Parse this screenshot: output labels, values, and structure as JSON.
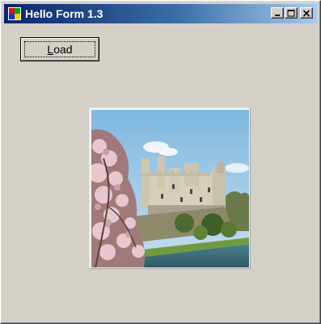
{
  "window": {
    "title": "Hello Form 1.3",
    "controls": {
      "minimize": "_",
      "maximize": "□",
      "close": "×"
    }
  },
  "toolbar": {
    "load_mnemonic": "L",
    "load_rest": "oad"
  },
  "picture": {
    "icon": "castle-photo"
  },
  "colors": {
    "title_start": "#0a246a",
    "title_end": "#a6caf0",
    "face": "#d4d0c8"
  }
}
